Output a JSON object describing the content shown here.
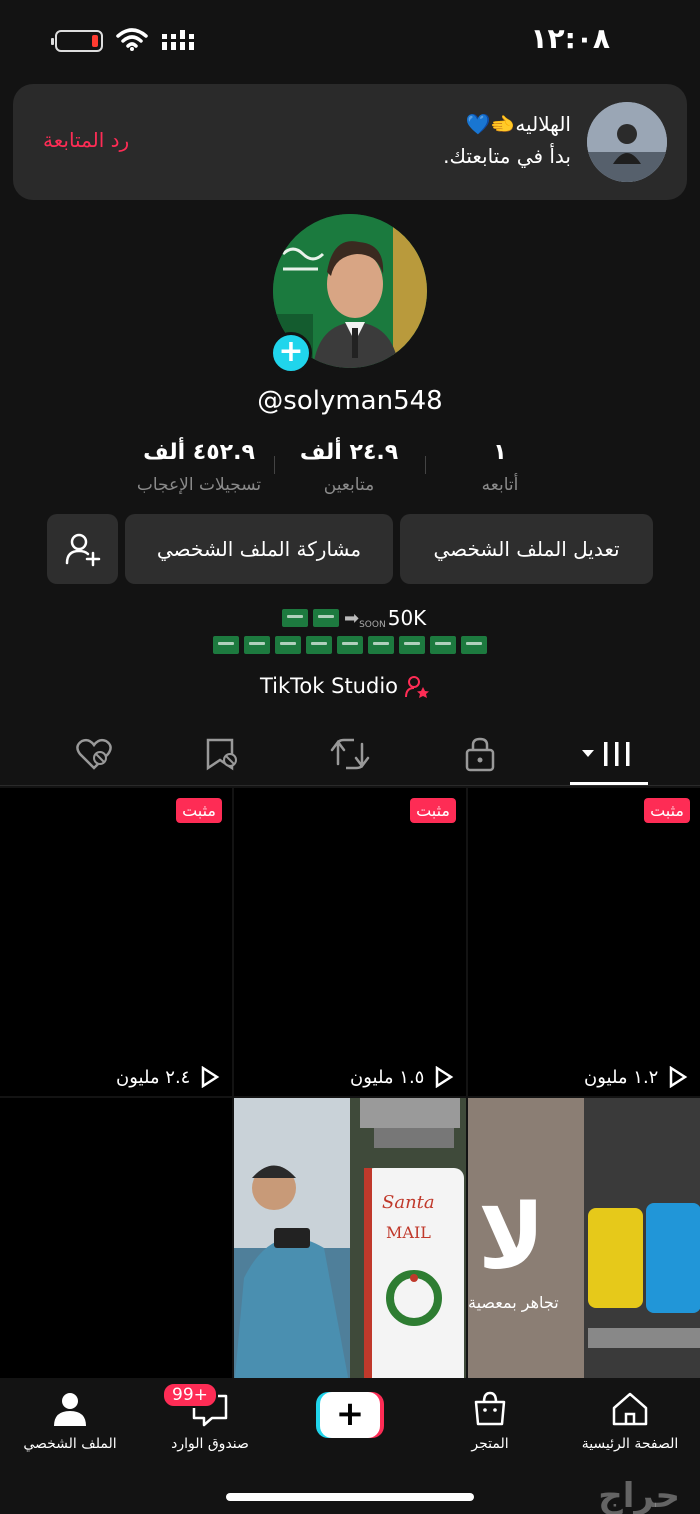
{
  "status_bar": {
    "time": "١٢:٠٨"
  },
  "notification": {
    "name": "الهلاليه🫲💙",
    "text": "بدأ في متابعتك.",
    "follow_back": "رد المتابعة"
  },
  "profile": {
    "username": "@solyman548",
    "add_badge": "+",
    "stats": [
      {
        "value": "١",
        "label": "أتابعه"
      },
      {
        "value": "٢٤.٩ ألف",
        "label": "متابعين"
      },
      {
        "value": "٤٥٢.٩ ألف",
        "label": "تسجيلات الإعجاب"
      }
    ],
    "buttons": {
      "edit": "تعديل الملف الشخصي",
      "share": "مشاركة الملف الشخصي"
    },
    "bio": {
      "goal": "50K",
      "soon": "SOON"
    },
    "studio": "TikTok Studio"
  },
  "videos": [
    {
      "pinned": "مثبت",
      "views": "١.٢ مليون"
    },
    {
      "pinned": "مثبت",
      "views": "١.٥ مليون"
    },
    {
      "pinned": "مثبت",
      "views": "٢.٤ مليون"
    }
  ],
  "thumbs": {
    "santa_mail": "Santa MAIL",
    "arabic_caption": "تجاهر بمعصية",
    "big_letter": "لا"
  },
  "bottom_nav": {
    "home": "الصفحة الرئيسية",
    "shop": "المتجر",
    "create": "+",
    "inbox": "صندوق الوارد",
    "inbox_badge": "99+",
    "profile": "الملف الشخصي"
  },
  "watermark": "حراج"
}
